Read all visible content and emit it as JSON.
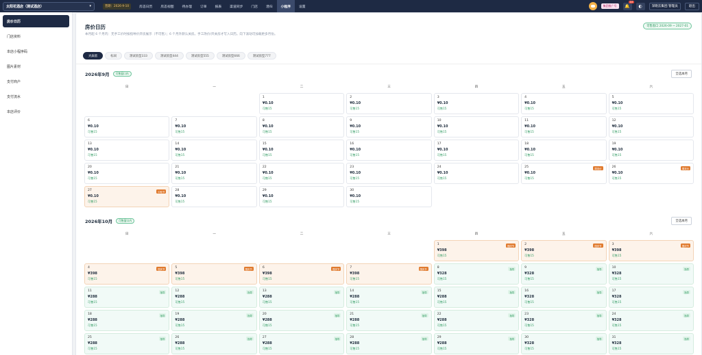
{
  "topbar": {
    "hotel": "太阳花酒店（测试酒店）",
    "date_chip": "营期：2026-9-10",
    "nav": [
      "房态日历",
      "房态视图",
      "待办理",
      "订单",
      "报表",
      "渠道同步",
      "门店",
      "潜归",
      "小程序",
      "设置"
    ],
    "active_nav": 8,
    "dist_btn": "集团推广号",
    "notif_count": "10",
    "user": "深晓云集团 管理员",
    "logout": "退出"
  },
  "sidebar": {
    "items": [
      "房价日历",
      "门店资料",
      "本店小程序码",
      "图片素材",
      "支付商户",
      "支付流水",
      "本店评价"
    ],
    "active": 0
  },
  "header": {
    "title": "房价日历",
    "desc": "本月起 6 个月内：无手工价时按指导价开房展示（不可售）；6 个月外默认关房。手工改价/开关房才写入日历。向下滚动可加载更多月份。",
    "range": "可售窗口 2026-09 ~ 2027-01"
  },
  "rooms": [
    "大床房",
    "标间",
    "测试房型333",
    "测试房型444",
    "测试房型555",
    "测试房型666",
    "测试房型777"
  ],
  "weekdays": [
    "日",
    "一",
    "二",
    "三",
    "四",
    "五",
    "六"
  ],
  "months": [
    {
      "title": "2026年9月",
      "badge": "可售窗口内",
      "select_all": "全选本月",
      "offset": 2,
      "days": [
        {
          "d": "1",
          "p": "¥0.10",
          "s": "可售15",
          "style": "plain",
          "tag": ""
        },
        {
          "d": "2",
          "p": "¥0.10",
          "s": "可售15",
          "style": "plain",
          "tag": ""
        },
        {
          "d": "3",
          "p": "¥0.10",
          "s": "可售15",
          "style": "plain",
          "tag": ""
        },
        {
          "d": "4",
          "p": "¥0.10",
          "s": "可售15",
          "style": "plain",
          "tag": ""
        },
        {
          "d": "5",
          "p": "¥0.10",
          "s": "可售15",
          "style": "plain",
          "tag": ""
        },
        {
          "d": "6",
          "p": "¥0.10",
          "s": "可售15",
          "style": "plain",
          "tag": ""
        },
        {
          "d": "7",
          "p": "¥0.10",
          "s": "可售15",
          "style": "plain",
          "tag": ""
        },
        {
          "d": "8",
          "p": "¥0.10",
          "s": "可售15",
          "style": "plain",
          "tag": ""
        },
        {
          "d": "9",
          "p": "¥0.10",
          "s": "可售15",
          "style": "plain",
          "tag": ""
        },
        {
          "d": "10",
          "p": "¥0.10",
          "s": "可售15",
          "style": "plain",
          "tag": ""
        },
        {
          "d": "11",
          "p": "¥0.10",
          "s": "可售15",
          "style": "plain",
          "tag": ""
        },
        {
          "d": "12",
          "p": "¥0.10",
          "s": "可售15",
          "style": "plain",
          "tag": ""
        },
        {
          "d": "13",
          "p": "¥0.10",
          "s": "可售15",
          "style": "plain",
          "tag": ""
        },
        {
          "d": "14",
          "p": "¥0.10",
          "s": "可售15",
          "style": "plain",
          "tag": ""
        },
        {
          "d": "15",
          "p": "¥0.10",
          "s": "可售15",
          "style": "plain",
          "tag": ""
        },
        {
          "d": "16",
          "p": "¥0.10",
          "s": "可售15",
          "style": "plain",
          "tag": ""
        },
        {
          "d": "17",
          "p": "¥0.10",
          "s": "可售15",
          "style": "plain",
          "tag": ""
        },
        {
          "d": "18",
          "p": "¥0.10",
          "s": "可售15",
          "style": "plain",
          "tag": ""
        },
        {
          "d": "19",
          "p": "¥0.10",
          "s": "可售15",
          "style": "plain",
          "tag": ""
        },
        {
          "d": "20",
          "p": "¥0.10",
          "s": "可售15",
          "style": "plain",
          "tag": ""
        },
        {
          "d": "21",
          "p": "¥0.10",
          "s": "可售15",
          "style": "plain",
          "tag": ""
        },
        {
          "d": "22",
          "p": "¥0.10",
          "s": "可售15",
          "style": "plain",
          "tag": ""
        },
        {
          "d": "23",
          "p": "¥0.10",
          "s": "可售15",
          "style": "plain",
          "tag": ""
        },
        {
          "d": "24",
          "p": "¥0.10",
          "s": "可售15",
          "style": "plain",
          "tag": ""
        },
        {
          "d": "25",
          "p": "¥0.10",
          "s": "可售15",
          "style": "plain",
          "tag": "周末价"
        },
        {
          "d": "26",
          "p": "¥0.10",
          "s": "可售15",
          "style": "plain",
          "tag": "周末价"
        },
        {
          "d": "27",
          "p": "¥0.10",
          "s": "可售15",
          "style": "peach",
          "tag": "中秋节"
        },
        {
          "d": "28",
          "p": "¥0.10",
          "s": "可售15",
          "style": "plain",
          "tag": ""
        },
        {
          "d": "29",
          "p": "¥0.10",
          "s": "可售15",
          "style": "plain",
          "tag": ""
        },
        {
          "d": "30",
          "p": "¥0.10",
          "s": "可售15",
          "style": "plain",
          "tag": ""
        }
      ]
    },
    {
      "title": "2026年10月",
      "badge": "可售窗口内",
      "select_all": "全选本月",
      "offset": 4,
      "days": [
        {
          "d": "1",
          "p": "¥398",
          "s": "可售15",
          "style": "peach",
          "tag": "国庆节"
        },
        {
          "d": "2",
          "p": "¥398",
          "s": "可售15",
          "style": "peach",
          "tag": "国庆节"
        },
        {
          "d": "3",
          "p": "¥398",
          "s": "可售15",
          "style": "peach",
          "tag": "国庆节"
        },
        {
          "d": "4",
          "p": "¥398",
          "s": "可售15",
          "style": "peach",
          "tag": "国庆节"
        },
        {
          "d": "5",
          "p": "¥398",
          "s": "可售15",
          "style": "peach",
          "tag": "国庆节"
        },
        {
          "d": "6",
          "p": "¥398",
          "s": "可售15",
          "style": "peach",
          "tag": "国庆节"
        },
        {
          "d": "7",
          "p": "¥398",
          "s": "可售15",
          "style": "peach",
          "tag": "国庆节"
        },
        {
          "d": "8",
          "p": "¥328",
          "s": "可售15",
          "style": "mint",
          "tag": "指导"
        },
        {
          "d": "9",
          "p": "¥328",
          "s": "可售15",
          "style": "mint",
          "tag": "指导"
        },
        {
          "d": "10",
          "p": "¥328",
          "s": "可售15",
          "style": "mint",
          "tag": "指导"
        },
        {
          "d": "11",
          "p": "¥288",
          "s": "可售15",
          "style": "mint",
          "tag": "指导"
        },
        {
          "d": "12",
          "p": "¥288",
          "s": "可售15",
          "style": "mint",
          "tag": "指导"
        },
        {
          "d": "13",
          "p": "¥288",
          "s": "可售15",
          "style": "mint",
          "tag": "指导"
        },
        {
          "d": "14",
          "p": "¥288",
          "s": "可售15",
          "style": "mint",
          "tag": "指导"
        },
        {
          "d": "15",
          "p": "¥288",
          "s": "可售15",
          "style": "mint",
          "tag": "指导"
        },
        {
          "d": "16",
          "p": "¥328",
          "s": "可售15",
          "style": "mint",
          "tag": "指导"
        },
        {
          "d": "17",
          "p": "¥328",
          "s": "可售15",
          "style": "mint",
          "tag": "指导"
        },
        {
          "d": "18",
          "p": "¥288",
          "s": "可售15",
          "style": "mint",
          "tag": "指导"
        },
        {
          "d": "19",
          "p": "¥288",
          "s": "可售15",
          "style": "mint",
          "tag": "指导"
        },
        {
          "d": "20",
          "p": "¥288",
          "s": "可售15",
          "style": "mint",
          "tag": "指导"
        },
        {
          "d": "21",
          "p": "¥288",
          "s": "可售15",
          "style": "mint",
          "tag": "指导"
        },
        {
          "d": "22",
          "p": "¥288",
          "s": "可售15",
          "style": "mint",
          "tag": "指导"
        },
        {
          "d": "23",
          "p": "¥328",
          "s": "可售15",
          "style": "mint",
          "tag": "指导"
        },
        {
          "d": "24",
          "p": "¥328",
          "s": "可售15",
          "style": "mint",
          "tag": "指导"
        },
        {
          "d": "25",
          "p": "¥288",
          "s": "可售15",
          "style": "mint",
          "tag": "指导"
        },
        {
          "d": "26",
          "p": "¥288",
          "s": "可售15",
          "style": "mint",
          "tag": "指导"
        },
        {
          "d": "27",
          "p": "¥288",
          "s": "可售15",
          "style": "mint",
          "tag": "指导"
        },
        {
          "d": "28",
          "p": "¥288",
          "s": "可售15",
          "style": "mint",
          "tag": "指导"
        },
        {
          "d": "29",
          "p": "¥288",
          "s": "可售15",
          "style": "mint",
          "tag": "指导"
        },
        {
          "d": "30",
          "p": "¥328",
          "s": "可售15",
          "style": "mint",
          "tag": "指导"
        },
        {
          "d": "31",
          "p": "¥328",
          "s": "可售15",
          "style": "mint",
          "tag": "指导"
        }
      ]
    }
  ]
}
